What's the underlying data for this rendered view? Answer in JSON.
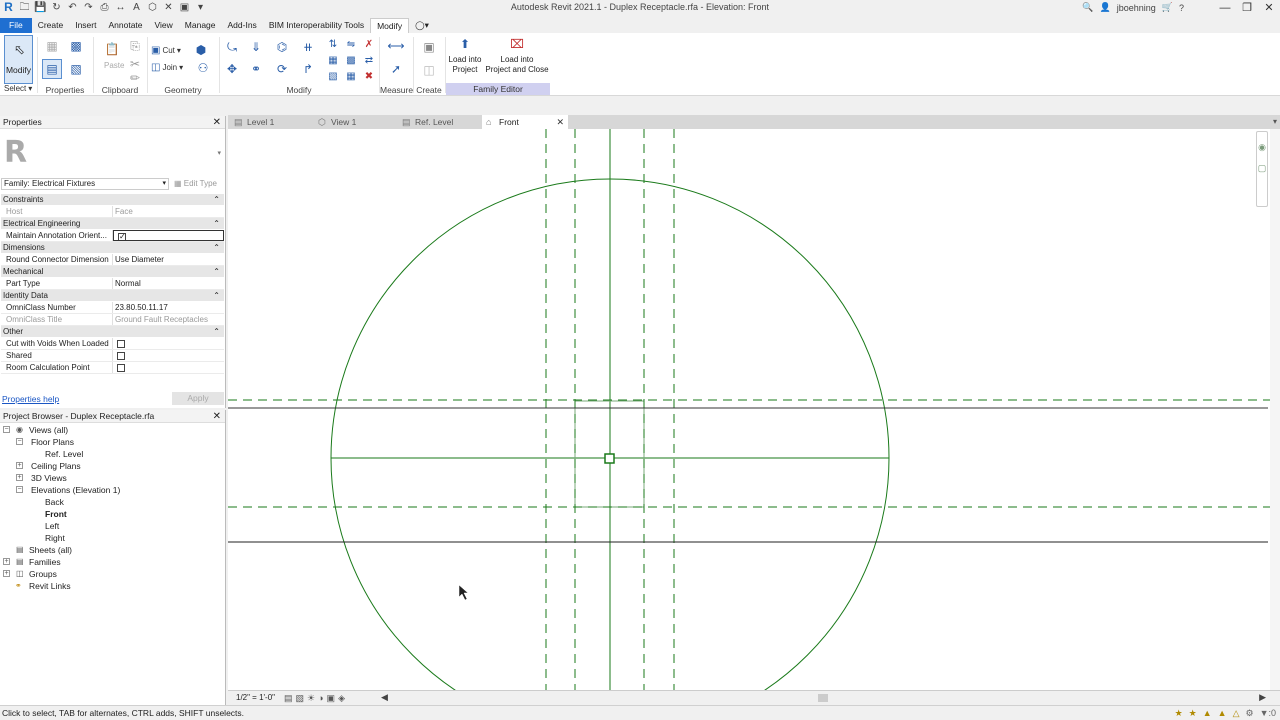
{
  "titlebar": {
    "title": "Autodesk Revit 2021.1 - Duplex Receptacle.rfa - Elevation: Front",
    "user": "jboehning"
  },
  "ribbon_tabs": [
    "File",
    "Create",
    "Insert",
    "Annotate",
    "View",
    "Manage",
    "Add-Ins",
    "BIM Interoperability Tools",
    "Modify"
  ],
  "ribbon": {
    "modify_label": "Modify",
    "select_label": "Select",
    "panels": {
      "properties": "Properties",
      "clipboard": "Clipboard",
      "geometry": "Geometry",
      "modify": "Modify",
      "measure": "Measure",
      "create": "Create",
      "family_editor": "Family Editor"
    },
    "paste_label": "Paste",
    "cut_label": "Cut",
    "join_label": "Join",
    "load_into_project": "Load into\nProject",
    "load_into_project_close": "Load into\nProject and Close"
  },
  "properties": {
    "title": "Properties",
    "family": "Family: Electrical Fixtures",
    "edit_type": "Edit Type",
    "groups": {
      "constraints": "Constraints",
      "electrical": "Electrical Engineering",
      "dimensions": "Dimensions",
      "mechanical": "Mechanical",
      "identity": "Identity Data",
      "other": "Other"
    },
    "rows": {
      "host_k": "Host",
      "host_v": "Face",
      "maint_k": "Maintain Annotation Orient...",
      "round_k": "Round Connector Dimension",
      "round_v": "Use Diameter",
      "part_k": "Part Type",
      "part_v": "Normal",
      "omni_num_k": "OmniClass Number",
      "omni_num_v": "23.80.50.11.17",
      "omni_title_k": "OmniClass Title",
      "omni_title_v": "Ground Fault Receptacles",
      "cut_k": "Cut with Voids When Loaded",
      "shared_k": "Shared",
      "room_k": "Room Calculation Point"
    },
    "help": "Properties help",
    "apply": "Apply"
  },
  "browser": {
    "title": "Project Browser - Duplex Receptacle.rfa",
    "items": {
      "views": "Views (all)",
      "floor": "Floor Plans",
      "reflevel": "Ref. Level",
      "ceiling": "Ceiling Plans",
      "threed": "3D Views",
      "elev": "Elevations (Elevation 1)",
      "back": "Back",
      "front": "Front",
      "left": "Left",
      "right": "Right",
      "sheets": "Sheets (all)",
      "families": "Families",
      "groups": "Groups",
      "links": "Revit Links"
    }
  },
  "view_tabs": [
    "Level 1",
    "View 1",
    "Ref. Level",
    "Front"
  ],
  "view_control": {
    "scale": "1/2\" = 1'-0\""
  },
  "status": {
    "message": "Click to select, TAB for alternates, CTRL adds, SHIFT unselects.",
    "filter_count": ":0"
  },
  "colors": {
    "accent": "#1f6fd1",
    "geometry": "#1a7a1a",
    "family_editor": "#d0d0f0"
  }
}
